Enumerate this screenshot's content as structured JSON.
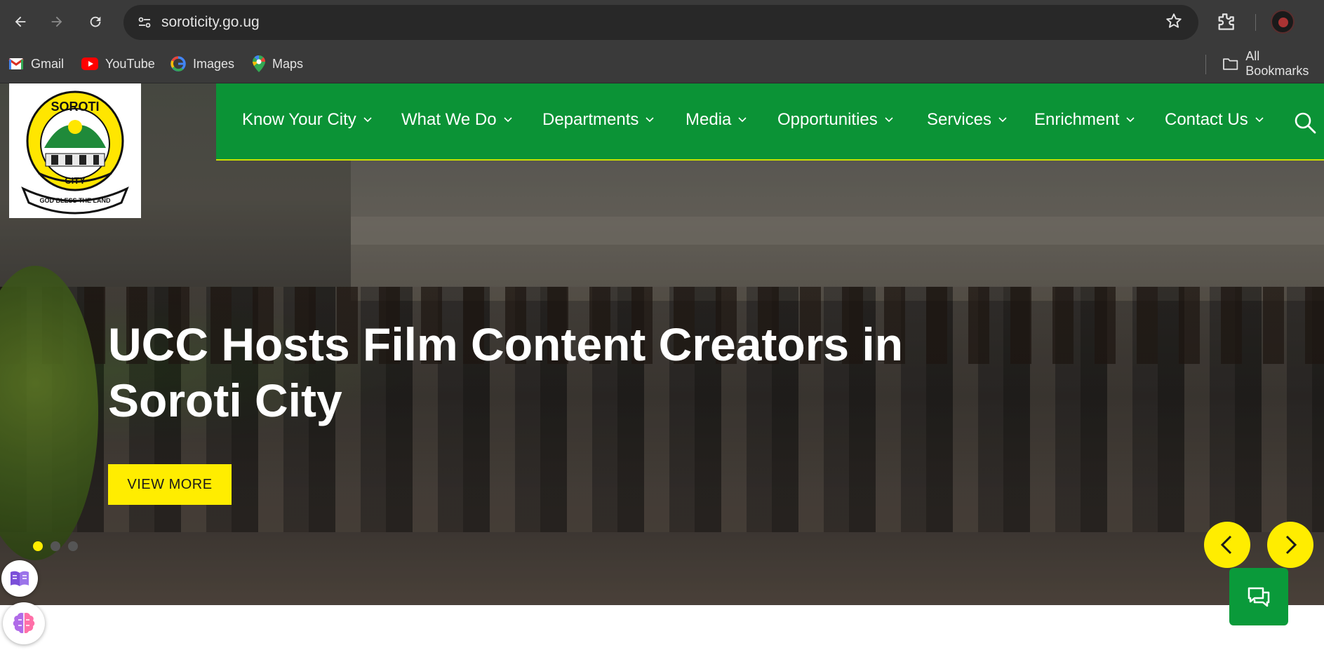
{
  "browser": {
    "url": "soroticity.go.ug",
    "bookmarks": [
      {
        "label": "Gmail",
        "icon": "gmail-icon"
      },
      {
        "label": "YouTube",
        "icon": "youtube-icon"
      },
      {
        "label": "Images",
        "icon": "google-icon"
      },
      {
        "label": "Maps",
        "icon": "maps-icon"
      }
    ],
    "all_bookmarks": "All Bookmarks"
  },
  "logo": {
    "top_text": "SOROTI",
    "city_text": "CITY",
    "motto": "GOD BLESS THE LAND"
  },
  "nav": {
    "items": [
      {
        "label": "Know Your City"
      },
      {
        "label": "What We Do"
      },
      {
        "label": "Departments"
      },
      {
        "label": "Media"
      },
      {
        "label": "Opportunities"
      },
      {
        "label": "Services"
      },
      {
        "label": "Enrichment"
      },
      {
        "label": "Contact Us"
      }
    ]
  },
  "hero": {
    "title": "UCC Hosts Film Content Creators in Soroti City",
    "button_label": "VIEW MORE",
    "slide_count": 3,
    "active_slide": 1
  },
  "colors": {
    "nav_green": "#0b9336",
    "accent_yellow": "#ffed00",
    "chat_green": "#0a9a3a",
    "chrome_dark": "#3a3a3a"
  }
}
